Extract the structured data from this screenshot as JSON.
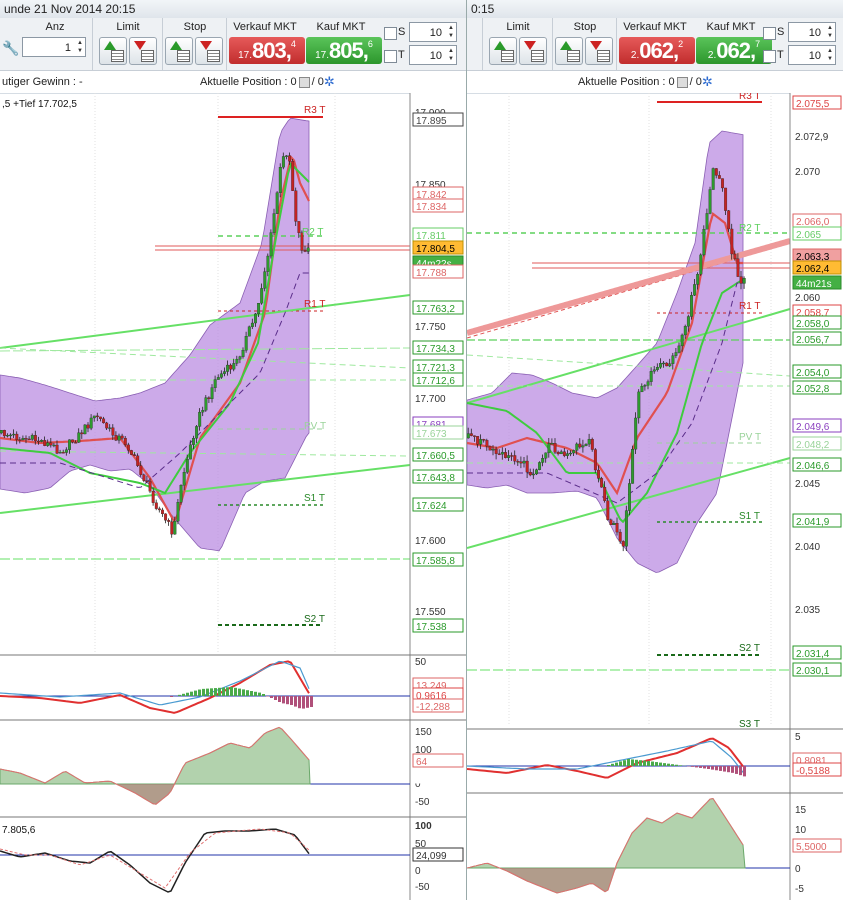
{
  "left": {
    "title": "unde  21 Nov 2014 20:15",
    "groups": {
      "anz": "Anz",
      "limit": "Limit",
      "stop": "Stop",
      "sell": "Verkauf MKT",
      "buy": "Kauf MKT"
    },
    "quantity": "1",
    "sell_quote": {
      "prefix": "17.",
      "big": "803,",
      "sup": "4"
    },
    "buy_quote": {
      "prefix": "17.",
      "big": "805,",
      "sup": "6"
    },
    "s_label": "S",
    "t_label": "T",
    "s_value": "10",
    "t_value": "10",
    "info_left": "utiger Gewinn : -",
    "info_pos": "Aktuelle Position : 0",
    "info_zero": "/ 0",
    "legend": ",5 +Tief 17.702,5",
    "ind3_legend": "7.805,6",
    "axis_ticks": [
      "17.900",
      "17.850",
      "17.750",
      "17.700",
      "17.600",
      "17.550"
    ],
    "axis_boxes": [
      "17.895",
      "17.842",
      "17.834",
      "17.811",
      "17.804,5",
      "44m22s",
      "17.788",
      "17.763,2",
      "17.734,3",
      "17.721,3",
      "17.712,6",
      "17.681",
      "17.673",
      "17.660,5",
      "17.643,8",
      "17.624",
      "17.585,8",
      "17.538"
    ],
    "level_labels": {
      "r3": "R3 T",
      "r2": "R2 T",
      "r1": "R1 T",
      "pv": "PV T",
      "s1": "S1 T",
      "s2": "S2 T"
    },
    "ind1_ticks": [
      "50",
      "13,249",
      "0,9616",
      "-12,288"
    ],
    "ind2_ticks": [
      "150",
      "100",
      "64",
      "50",
      "0",
      "-50"
    ],
    "ind3_ticks": [
      "100",
      "50",
      "24,099",
      "0",
      "-50"
    ]
  },
  "right": {
    "title": "0:15",
    "groups": {
      "limit": "Limit",
      "stop": "Stop",
      "sell": "Verkauf MKT",
      "buy": "Kauf MKT"
    },
    "sell_quote": {
      "prefix": "2.",
      "big": "062,",
      "sup": "2"
    },
    "buy_quote": {
      "prefix": "2.",
      "big": "062,",
      "sup": "7"
    },
    "s_label": "S",
    "t_label": "T",
    "s_value": "10",
    "t_value": "10",
    "info_pos": "Aktuelle Position : 0",
    "info_zero": "/ 0",
    "axis_ticks": [
      "2.072,9",
      "2.070",
      "2.060",
      "2.045",
      "2.040",
      "2.035"
    ],
    "axis_boxes": [
      "2.075,5",
      "2.066,0",
      "2.065",
      "2.063,3",
      "2.062,4",
      "44m21s",
      "2.058,7",
      "2.058,0",
      "2.056,7",
      "2.054,0",
      "2.052,8",
      "2.049,6",
      "2.048,2",
      "2.046,6",
      "2.041,9",
      "2.031,4",
      "2.030,1"
    ],
    "level_labels": {
      "r3": "R3 T",
      "r2": "R2 T",
      "r1": "R1 T",
      "pv": "PV T",
      "s1": "S1 T",
      "s2": "S2 T",
      "s3": "S3 T"
    },
    "ind1_ticks": [
      "5",
      "0,8081",
      "-0,5188"
    ],
    "ind2_ticks": [
      "15",
      "10",
      "5,5000",
      "0",
      "-5"
    ]
  },
  "colors": {
    "sell": "#c12d2d",
    "buy": "#2c962c",
    "band": "#b989e0",
    "bull": "#2e9a2e",
    "bear": "#c42323"
  }
}
